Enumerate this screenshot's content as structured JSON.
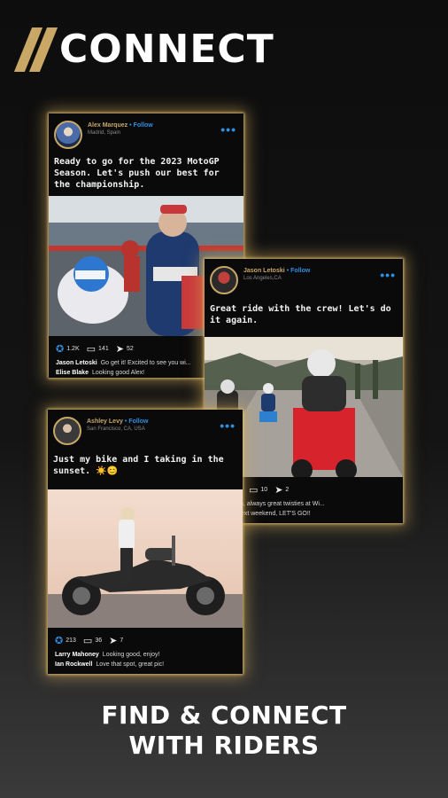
{
  "header": {
    "title": "CONNECT"
  },
  "posts": [
    {
      "name": "Alex Marquez",
      "follow": "Follow",
      "location": "Madrid, Spain",
      "text": "Ready to go for the 2023 MotoGP Season. Let's push our best for the championship.",
      "likes": "1.2K",
      "comments": "141",
      "shares": "52",
      "replies": [
        {
          "user": "Jason Letoski",
          "text": "Go get it! Excited to see you wi..."
        },
        {
          "user": "Elise Blake",
          "text": "Looking good Alex!"
        }
      ]
    },
    {
      "name": "Jason Letoski",
      "follow": "Follow",
      "location": "Los Angeles,CA",
      "text": "Great ride with the crew! Let's do it again.",
      "likes": "",
      "comments": "10",
      "shares": "2",
      "replies": [
        {
          "user": "",
          "text": "...ife down, always great twisties at Wi..."
        },
        {
          "user": "",
          "text": "I'm free next weekend, LET'S GO!!"
        }
      ]
    },
    {
      "name": "Ashley Levy",
      "follow": "Follow",
      "location": "San Francisco, CA, USA",
      "text": "Just my bike and I taking in the sunset. ☀️😊",
      "likes": "213",
      "comments": "36",
      "shares": "7",
      "replies": [
        {
          "user": "Larry Mahoney",
          "text": "Looking good, enjoy!"
        },
        {
          "user": "Ian Rockwell",
          "text": "Love that spot, great pic!"
        }
      ]
    }
  ],
  "footer": {
    "line1": "FIND & CONNECT",
    "line2": "WITH RIDERS"
  },
  "colors": {
    "accent": "#c9a865",
    "link": "#2f8fe0",
    "background": "#0d0d0d"
  },
  "icons": [
    "more-dots-icon",
    "like-icon",
    "comment-icon",
    "share-icon"
  ]
}
